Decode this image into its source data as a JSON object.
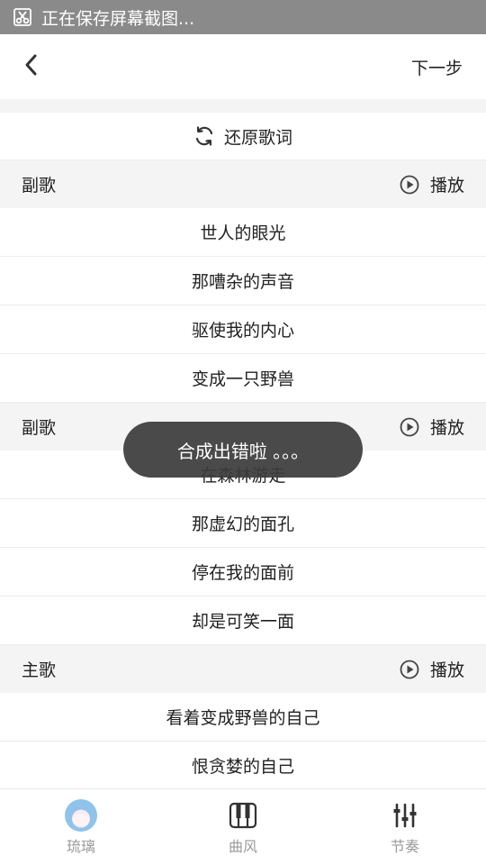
{
  "status_bar": {
    "text": "正在保存屏幕截图...",
    "icon": "scissors-icon"
  },
  "header": {
    "back_icon": "chevron-left-icon",
    "next_label": "下一步"
  },
  "restore": {
    "label": "还原歌词",
    "icon": "refresh-icon"
  },
  "sections": [
    {
      "title": "副歌",
      "play_label": "播放",
      "lyrics": [
        "世人的眼光",
        "那嘈杂的声音",
        "驱使我的内心",
        "变成一只野兽"
      ]
    },
    {
      "title": "副歌",
      "play_label": "播放",
      "lyrics": [
        "在森林游走",
        "那虚幻的面孔",
        "停在我的面前",
        "却是可笑一面"
      ]
    },
    {
      "title": "主歌",
      "play_label": "播放",
      "lyrics": [
        "看着变成野兽的自己",
        "恨贪婪的自己"
      ]
    }
  ],
  "toast": "合成出错啦 。。。",
  "bottom_nav": [
    {
      "label": "琉璃",
      "icon": "avatar-icon"
    },
    {
      "label": "曲风",
      "icon": "piano-icon"
    },
    {
      "label": "节奏",
      "icon": "sliders-icon"
    }
  ]
}
